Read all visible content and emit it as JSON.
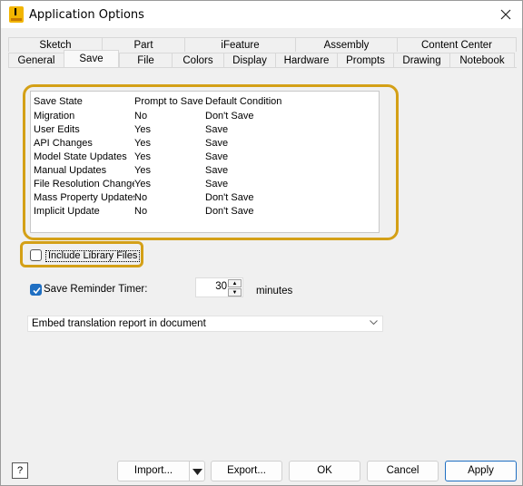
{
  "window": {
    "title": "Application Options",
    "app_icon_glyph": "I"
  },
  "tabs": {
    "row1": [
      "Sketch",
      "Part",
      "iFeature",
      "Assembly",
      "Content Center"
    ],
    "row2": [
      "General",
      "Save",
      "File",
      "Colors",
      "Display",
      "Hardware",
      "Prompts",
      "Drawing",
      "Notebook"
    ],
    "active": "Save"
  },
  "save_list": {
    "headers": [
      "Save State",
      "Prompt to Save",
      "Default Condition"
    ],
    "rows": [
      [
        "Migration",
        "No",
        "Don't Save"
      ],
      [
        "User Edits",
        "Yes",
        "Save"
      ],
      [
        "API Changes",
        "Yes",
        "Save"
      ],
      [
        "Model State Updates",
        "Yes",
        "Save"
      ],
      [
        "Manual Updates",
        "Yes",
        "Save"
      ],
      [
        "File Resolution Changes",
        "Yes",
        "Save"
      ],
      [
        "Mass Property Updates",
        "No",
        "Don't Save"
      ],
      [
        "Implicit Update",
        "No",
        "Don't Save"
      ]
    ]
  },
  "include_library": {
    "label": "Include Library Files",
    "checked": false
  },
  "save_reminder": {
    "label": "Save Reminder Timer:",
    "checked": true,
    "value": "30",
    "unit": "minutes"
  },
  "translation_dropdown": {
    "value": "Embed translation report in document"
  },
  "buttons": {
    "help": "?",
    "import": "Import...",
    "export": "Export...",
    "ok": "OK",
    "cancel": "Cancel",
    "apply": "Apply"
  },
  "colors": {
    "highlight": "#d4a017",
    "accent": "#1f6fc2"
  }
}
